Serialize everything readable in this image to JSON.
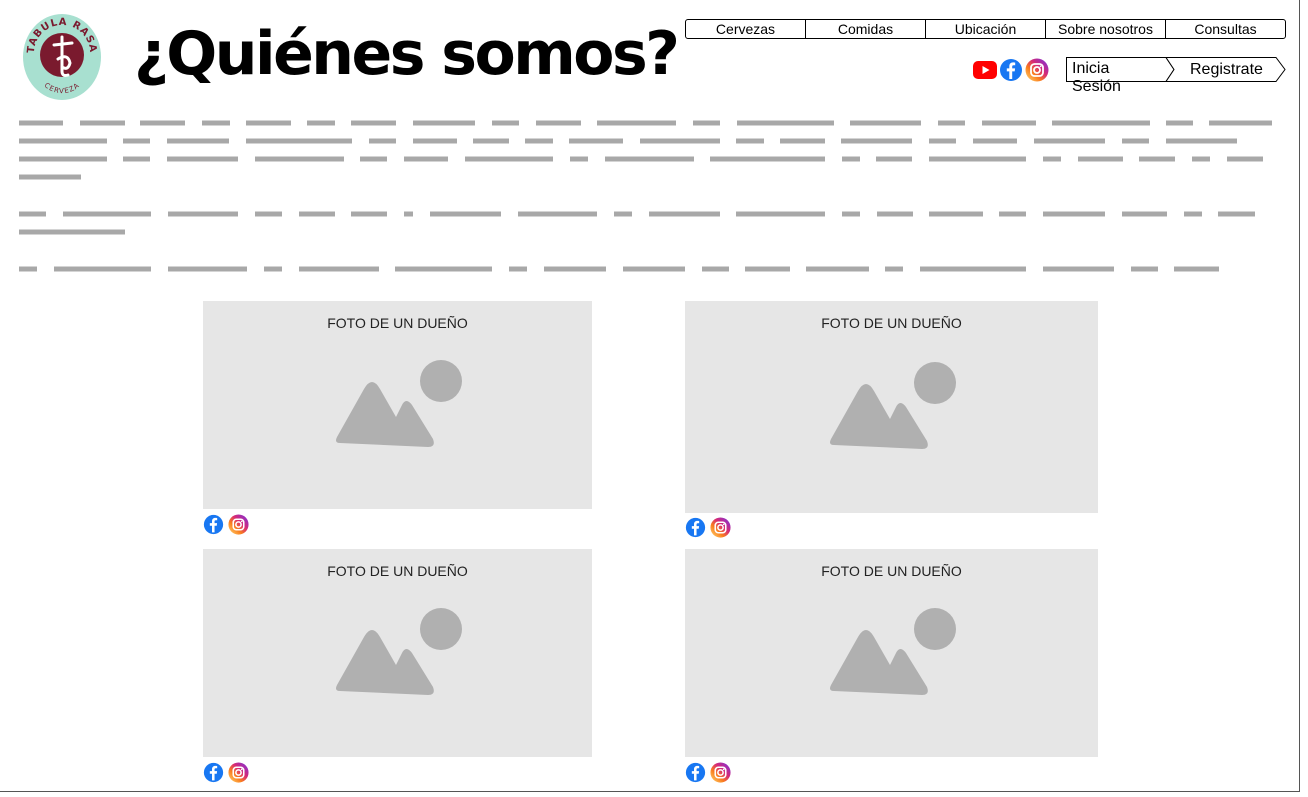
{
  "brand": {
    "logo_text_top": "TABULA RASA",
    "logo_text_bottom": "CERVEZA",
    "colors": {
      "mint": "#a8e0d0",
      "wine": "#7a1a2e"
    }
  },
  "page_title": "¿Quiénes somos?",
  "nav": {
    "items": [
      {
        "label": "Cervezas"
      },
      {
        "label": "Comidas"
      },
      {
        "label": "Ubicación"
      },
      {
        "label": "Sobre nosotros"
      },
      {
        "label": "Consultas"
      }
    ]
  },
  "social_header": {
    "icons": [
      "youtube-icon",
      "facebook-icon",
      "instagram-icon"
    ]
  },
  "auth": {
    "login_label": "Inicia Sesión",
    "register_label": "Registrate"
  },
  "owners": [
    {
      "caption": "FOTO DE UN DUEÑO"
    },
    {
      "caption": "FOTO DE UN DUEÑO"
    },
    {
      "caption": "FOTO DE UN DUEÑO"
    },
    {
      "caption": "FOTO DE UN DUEÑO"
    }
  ],
  "colors": {
    "placeholder_bg": "#e6e6e6",
    "placeholder_shape": "#b0b0b0",
    "text_line": "#a8a8a8",
    "youtube": "#ff0000",
    "facebook": "#1877f2"
  }
}
